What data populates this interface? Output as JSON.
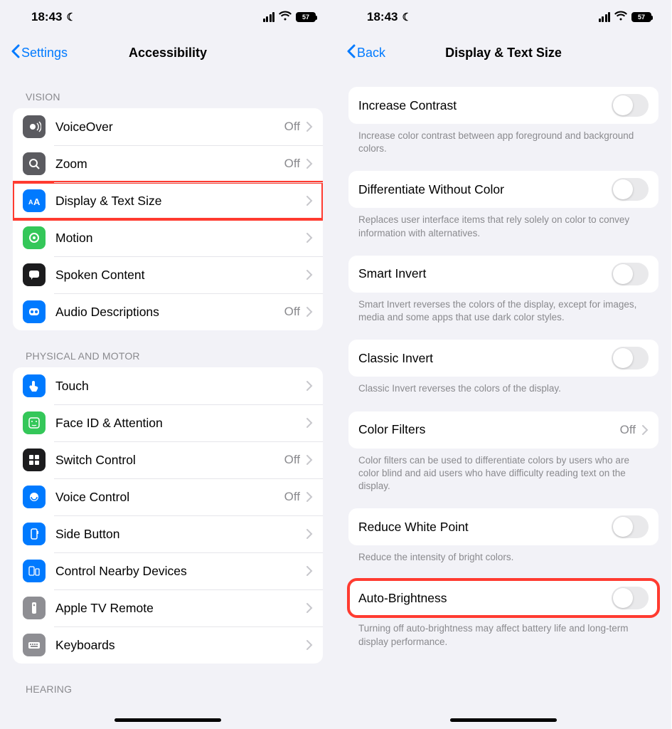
{
  "status": {
    "time": "18:43",
    "battery": "57"
  },
  "left": {
    "back": "Settings",
    "title": "Accessibility",
    "sections": {
      "vision": {
        "header": "VISION",
        "items": [
          {
            "label": "VoiceOver",
            "value": "Off"
          },
          {
            "label": "Zoom",
            "value": "Off"
          },
          {
            "label": "Display & Text Size",
            "value": ""
          },
          {
            "label": "Motion",
            "value": ""
          },
          {
            "label": "Spoken Content",
            "value": ""
          },
          {
            "label": "Audio Descriptions",
            "value": "Off"
          }
        ]
      },
      "physical": {
        "header": "PHYSICAL AND MOTOR",
        "items": [
          {
            "label": "Touch",
            "value": ""
          },
          {
            "label": "Face ID & Attention",
            "value": ""
          },
          {
            "label": "Switch Control",
            "value": "Off"
          },
          {
            "label": "Voice Control",
            "value": "Off"
          },
          {
            "label": "Side Button",
            "value": ""
          },
          {
            "label": "Control Nearby Devices",
            "value": ""
          },
          {
            "label": "Apple TV Remote",
            "value": ""
          },
          {
            "label": "Keyboards",
            "value": ""
          }
        ]
      },
      "hearing": {
        "header": "HEARING"
      }
    }
  },
  "right": {
    "back": "Back",
    "title": "Display & Text Size",
    "rows": {
      "increase_contrast": {
        "label": "Increase Contrast",
        "desc": "Increase color contrast between app foreground and background colors."
      },
      "diff_color": {
        "label": "Differentiate Without Color",
        "desc": "Replaces user interface items that rely solely on color to convey information with alternatives."
      },
      "smart_invert": {
        "label": "Smart Invert",
        "desc": "Smart Invert reverses the colors of the display, except for images, media and some apps that use dark color styles."
      },
      "classic_invert": {
        "label": "Classic Invert",
        "desc": "Classic Invert reverses the colors of the display."
      },
      "color_filters": {
        "label": "Color Filters",
        "value": "Off",
        "desc": "Color filters can be used to differentiate colors by users who are color blind and aid users who have difficulty reading text on the display."
      },
      "reduce_white": {
        "label": "Reduce White Point",
        "desc": "Reduce the intensity of bright colors."
      },
      "auto_brightness": {
        "label": "Auto-Brightness",
        "desc": "Turning off auto-brightness may affect battery life and long-term display performance."
      }
    }
  }
}
